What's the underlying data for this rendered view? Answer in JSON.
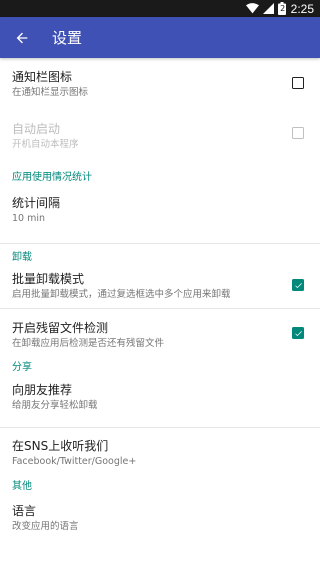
{
  "status_bar": {
    "time": "2:25",
    "battery": "2"
  },
  "app_bar": {
    "title": "设置"
  },
  "general": [
    {
      "title": "通知栏图标",
      "subtitle": "在通知栏显示图标",
      "checked": false,
      "enabled": true
    },
    {
      "title": "自动启动",
      "subtitle": "开机自动本程序",
      "checked": false,
      "enabled": false
    }
  ],
  "usage_stats": {
    "header": "应用使用情况统计",
    "interval_title": "统计间隔",
    "interval_value": "10 min"
  },
  "uninstall": {
    "header": "卸载",
    "batch": {
      "title": "批量卸载模式",
      "subtitle": "启用批量卸载模式，通过复选框选中多个应用来卸载",
      "checked": true
    },
    "residual": {
      "title": "开启残留文件检测",
      "subtitle": "在卸载应用后检测是否还有残留文件",
      "checked": true
    }
  },
  "share": {
    "header": "分享",
    "recommend": {
      "title": "向朋友推荐",
      "subtitle": "给朋友分享轻松卸载"
    },
    "follow": {
      "title": "在SNS上收听我们",
      "subtitle": "Facebook/Twitter/Google+"
    }
  },
  "other": {
    "header": "其他",
    "language": {
      "title": "语言",
      "subtitle": "改变应用的语言"
    }
  },
  "colors": {
    "primary": "#3f51b5",
    "accent": "#00897b",
    "status_bar": "#1a1a1a"
  }
}
